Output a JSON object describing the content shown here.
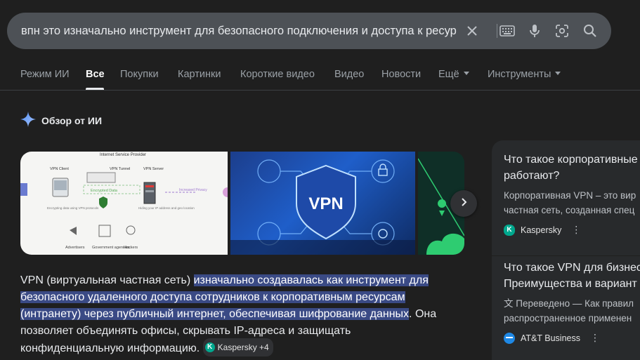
{
  "search": {
    "query": "впн это изначально инструмент для безопасного подключения и доступа к ресур"
  },
  "tabs": [
    {
      "label": "Режим ИИ"
    },
    {
      "label": "Все"
    },
    {
      "label": "Покупки"
    },
    {
      "label": "Картинки"
    },
    {
      "label": "Короткие видео"
    },
    {
      "label": "Видео"
    },
    {
      "label": "Новости"
    },
    {
      "label": "Ещё"
    },
    {
      "label": "Инструменты"
    }
  ],
  "ai_overview": {
    "title": "Обзор от ИИ",
    "diagram": {
      "isp": "Internet Service Provider",
      "vpn_client": "VPN Client",
      "vpn_tunnel": "VPN Tunnel",
      "vpn_server": "VPN Server",
      "encrypted": "Encrypted Data",
      "increased": "Increased Privacy",
      "encrypting": "Encrypting data using VPN protocols",
      "hiding": "Hiding your IP address and geo location",
      "advertisers": "Advertisers",
      "government": "Government agencies",
      "hackers": "Hackers"
    },
    "vpn_badge": "VPN",
    "answer": {
      "lead": "VPN (виртуальная частная сеть) ",
      "highlight": "изначально создавалась как инструмент для безопасного удаленного доступа сотрудников к корпоративным ресурсам (интранету) через публичный интернет, обеспечивая шифрование данных",
      "tail": ". Она позволяет объединять офисы, скрывать IP-адреса и защищать конфиденциальную информацию. ",
      "source_chip": "Kaspersky +4"
    }
  },
  "side_results": [
    {
      "title_line1": "Что такое корпоративные",
      "title_line2": "работают?",
      "snippet_line1": "Корпоративная VPN – это вир",
      "snippet_line2": "частная сеть, созданная спец",
      "source": "Kaspersky"
    },
    {
      "title_line1": "Что такое VPN для бизнес",
      "title_line2": "Преимущества и вариант",
      "snippet_line1": "Переведено — Как правил",
      "snippet_line2": "распространенное применен",
      "source": "AT&T Business"
    }
  ],
  "colors": {
    "background": "#1f1f1f",
    "search_bar": "#4d5156",
    "highlight": "#3a4a85",
    "side_panel": "#282a2c"
  }
}
